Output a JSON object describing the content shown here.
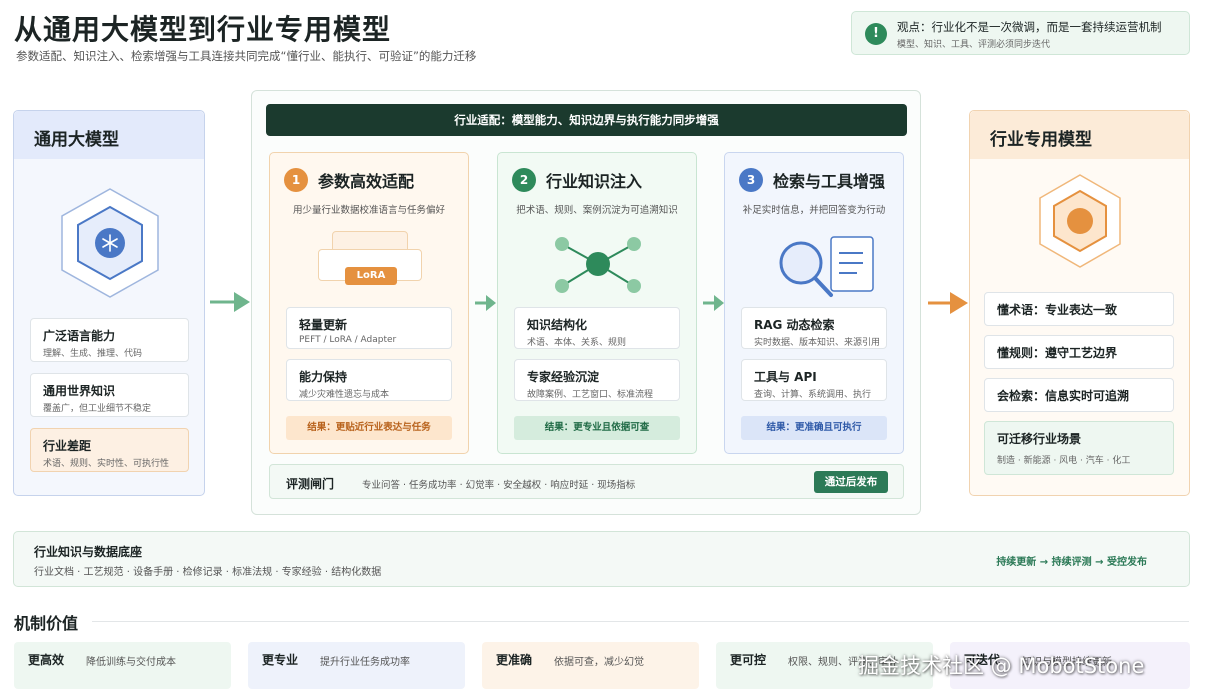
{
  "header": {
    "title": "从通用大模型到行业专用模型",
    "subtitle": "参数适配、知识注入、检索增强与工具连接共同完成“懂行业、能执行、可验证”的能力迁移"
  },
  "viewpoint": {
    "icon": "!",
    "title": "观点：行业化不是一次微调，而是一套持续运营机制",
    "sub": "模型、知识、工具、评测必须同步迭代"
  },
  "general_model": {
    "title": "通用大模型",
    "icon": "snowflake-icon",
    "cards": [
      {
        "title": "广泛语言能力",
        "sub": "理解、生成、推理、代码"
      },
      {
        "title": "通用世界知识",
        "sub": "覆盖广，但工业细节不稳定"
      },
      {
        "title": "行业差距",
        "sub": "术语、规则、实时性、可执行性"
      }
    ]
  },
  "center": {
    "bar": "行业适配：模型能力、知识边界与执行能力同步增强",
    "columns": [
      {
        "num": "1",
        "title": "参数高效适配",
        "desc": "用少量行业数据校准语言与任务偏好",
        "badge": "LoRA",
        "cards": [
          {
            "title": "轻量更新",
            "sub": "PEFT / LoRA / Adapter"
          },
          {
            "title": "能力保持",
            "sub": "减少灾难性遗忘与成本"
          }
        ],
        "result": "结果：更贴近行业表达与任务"
      },
      {
        "num": "2",
        "title": "行业知识注入",
        "desc": "把术语、规则、案例沉淀为可追溯知识",
        "cards": [
          {
            "title": "知识结构化",
            "sub": "术语、本体、关系、规则"
          },
          {
            "title": "专家经验沉淀",
            "sub": "故障案例、工艺窗口、标准流程"
          }
        ],
        "result": "结果：更专业且依据可查"
      },
      {
        "num": "3",
        "title": "检索与工具增强",
        "desc": "补足实时信息，并把回答变为行动",
        "cards": [
          {
            "title": "RAG 动态检索",
            "sub": "实时数据、版本知识、来源引用"
          },
          {
            "title": "工具与 API",
            "sub": "查询、计算、系统调用、执行"
          }
        ],
        "result": "结果：更准确且可执行"
      }
    ],
    "gate": {
      "title": "评测闸门",
      "items": "专业问答 · 任务成功率 · 幻觉率 · 安全越权 · 响应时延 · 现场指标",
      "button": "通过后发布"
    }
  },
  "industry_model": {
    "title": "行业专用模型",
    "cards": [
      {
        "title": "懂术语：专业表达一致",
        "sub": ""
      },
      {
        "title": "懂规则：遵守工艺边界",
        "sub": ""
      },
      {
        "title": "会检索：信息实时可追溯",
        "sub": ""
      },
      {
        "title": "可迁移行业场景",
        "sub": "制造 · 新能源 · 风电 · 汽车 · 化工"
      }
    ]
  },
  "base": {
    "title": "行业知识与数据底座",
    "items": "行业文档 · 工艺规范 · 设备手册 · 检修记录 · 标准法规 · 专家经验 · 结构化数据",
    "flow": "持续更新 → 持续评测 → 受控发布"
  },
  "mechanism": {
    "title": "机制价值",
    "cards": [
      {
        "title": "更高效",
        "sub": "降低训练与交付成本"
      },
      {
        "title": "更专业",
        "sub": "提升行业任务成功率"
      },
      {
        "title": "更准确",
        "sub": "依据可查，减少幻觉"
      },
      {
        "title": "更可控",
        "sub": "权限、规则、评测、审计"
      },
      {
        "title": "可迭代",
        "sub": "知识与模型持续更新"
      }
    ]
  },
  "watermark": "掘金技术社区 @ MobotStone",
  "colors": {
    "green": "#2e8a5b",
    "orange": "#e5913f",
    "blue": "#4a78c6",
    "dark": "#1b3a2e"
  }
}
